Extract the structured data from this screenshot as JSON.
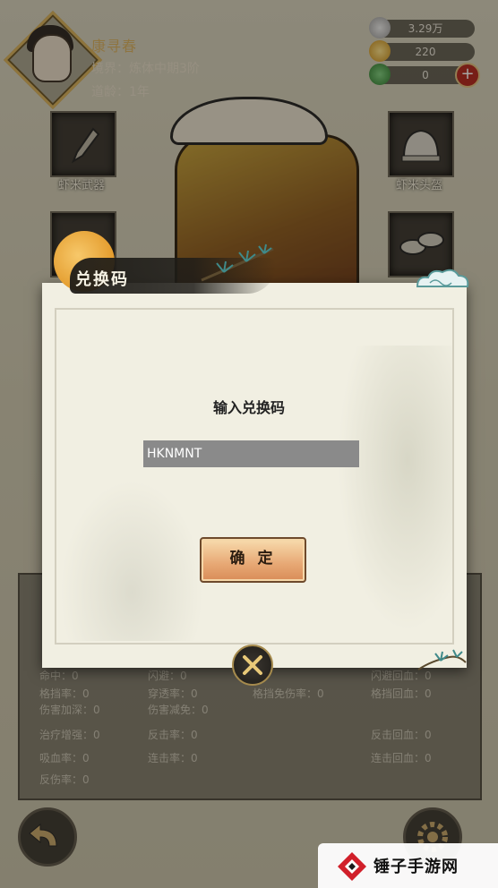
{
  "player": {
    "name": "康寻春",
    "realm": "境界：炼体中期3阶",
    "age": "道龄：1年"
  },
  "currencies": [
    {
      "icon": "silver-ingot-icon",
      "value": "3.29万"
    },
    {
      "icon": "gold-ingot-icon",
      "value": "220"
    },
    {
      "icon": "jade-icon",
      "value": "0"
    }
  ],
  "equipment": {
    "weapon": "虾米武器",
    "helmet": "虾米头盔"
  },
  "stats": {
    "row1": [
      "命中：0",
      "闪避：0",
      "闪避回血：0"
    ],
    "row2": [
      "格挡率：0",
      "穿透率：0",
      "格挡免伤率：0",
      "格挡回血：0"
    ],
    "row3": [
      "伤害加深：0",
      "伤害减免：0"
    ],
    "row4": [
      "治疗增强：0",
      "反击率：0",
      "反击回血：0"
    ],
    "row5": [
      "吸血率：0",
      "连击率：0",
      "连击回血：0"
    ],
    "row6": [
      "反伤率：0"
    ]
  },
  "dialog": {
    "title": "兑换码",
    "prompt": "输入兑换码",
    "code_value": "HKNMNT",
    "confirm_label": "确 定"
  },
  "watermark": {
    "text": "锤子手游网"
  },
  "colors": {
    "confirm_gradient_top": "#f8dcae",
    "confirm_gradient_bottom": "#d98c58",
    "input_bg": "#8a8a8a",
    "name_gold": "#d9b060"
  }
}
